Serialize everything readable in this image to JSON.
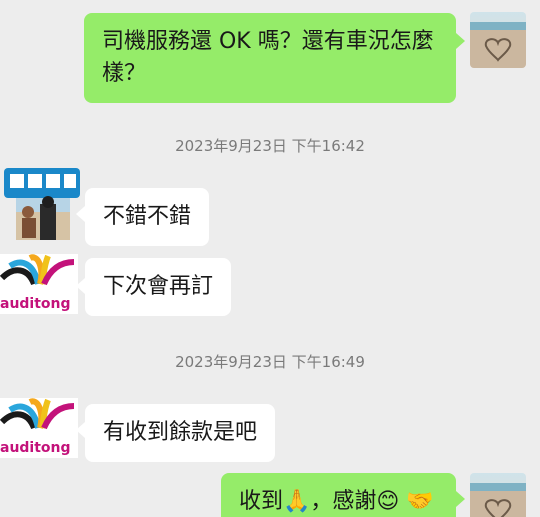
{
  "messages": [
    {
      "side": "right",
      "text": "司機服務還 OK 嗎？還有車況怎麼樣？"
    },
    {
      "side": "left",
      "text": "不錯不錯"
    },
    {
      "side": "left",
      "text": "下次會再訂"
    },
    {
      "side": "left",
      "text": "有收到餘款是吧"
    },
    {
      "side": "right",
      "text": "收到🙏，感謝😊 🤝"
    }
  ],
  "timestamps": [
    "2023年9月23日 下午16:42",
    "2023年9月23日 下午16:49"
  ],
  "logos": {
    "brand": "auditong"
  },
  "colors": {
    "background": "#ededed",
    "outgoing_bubble": "#95ec69",
    "incoming_bubble": "#ffffff",
    "timestamp": "#7a7a7a",
    "brand_text": "#c3127a"
  }
}
